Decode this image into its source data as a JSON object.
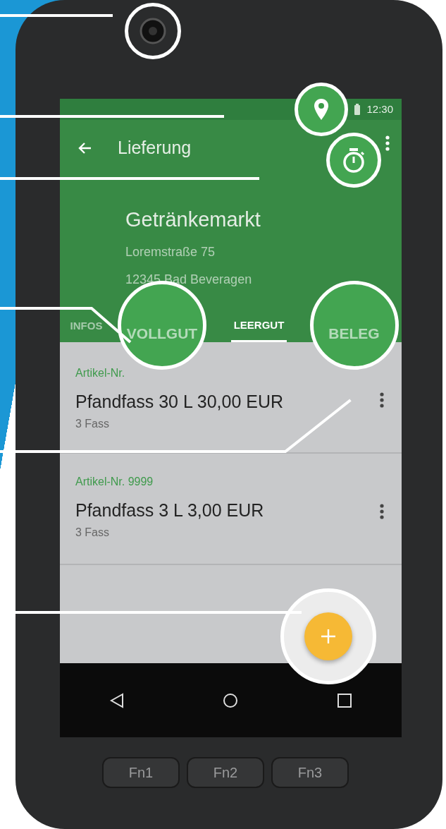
{
  "camera": {
    "highlighted": true
  },
  "status_bar": {
    "time": "12:30",
    "location_highlighted": true
  },
  "toolbar": {
    "title": "Lieferung",
    "timer_highlighted": true
  },
  "customer": {
    "name": "Getränkemarkt",
    "street": "Loremstraße 75",
    "city": "12345 Bad Beveragen"
  },
  "tabs": [
    {
      "label": "INFOS",
      "selected": false,
      "highlighted": false
    },
    {
      "label": "VOLLGUT",
      "selected": false,
      "highlighted": true
    },
    {
      "label": "LEERGUT",
      "selected": true,
      "highlighted": false
    },
    {
      "label": "BELEG",
      "selected": false,
      "highlighted": true
    }
  ],
  "items": [
    {
      "article": "Artikel-Nr.",
      "title": "Pfandfass 30 L 30,00 EUR",
      "quantity": "3 Fass"
    },
    {
      "article": "Artikel-Nr. 9999",
      "title": "Pfandfass 3 L 3,00 EUR",
      "quantity": "3 Fass"
    }
  ],
  "fab": {
    "highlighted": true
  },
  "hardware_keys": [
    "Fn1",
    "Fn2",
    "Fn3"
  ]
}
